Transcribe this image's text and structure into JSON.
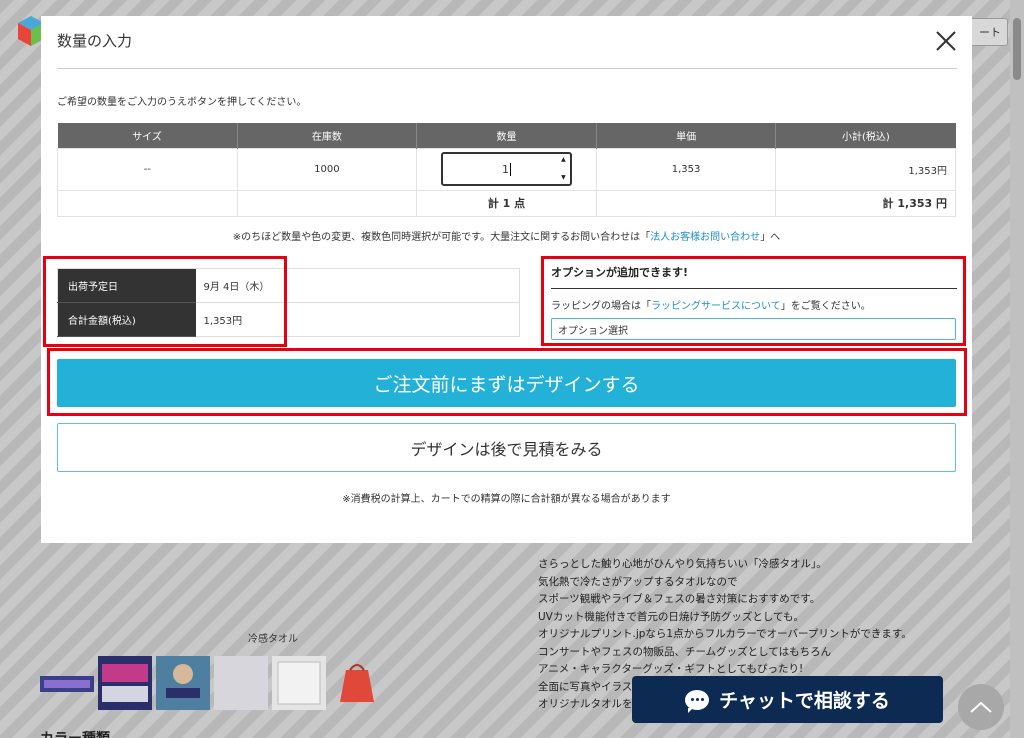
{
  "modal": {
    "title": "数量の入力",
    "instruction": "ご希望の数量をご入力のうえボタンを押してください。",
    "table": {
      "headers": [
        "サイズ",
        "在庫数",
        "数量",
        "単価",
        "小計(税込)"
      ],
      "row": {
        "size": "--",
        "stock": "1000",
        "quantity": "1",
        "unit_price": "1,353",
        "subtotal": "1,353円"
      },
      "total_qty": "計 1 点",
      "total_price": "計 1,353 円"
    },
    "note": {
      "before": "※のちほど数量や色の変更、複数色同時選択が可能です。大量注文に関するお問い合わせは「",
      "link": "法人お客様お問い合わせ",
      "after": "」へ"
    },
    "shipping": {
      "date_label": "出荷予定日",
      "date_value": "9月 4日（木）",
      "total_label": "合計金額(税込)",
      "total_value": "1,353円"
    },
    "options": {
      "title": "オプションが追加できます!",
      "desc_before": "ラッピングの場合は「",
      "desc_link": "ラッピングサービスについて",
      "desc_after": "」をご覧ください。",
      "select_value": "オプション選択"
    },
    "design_button": "ご注文前にまずはデザインする",
    "later_button": "デザインは後で見積をみる",
    "tax_note": "※消費税の計算上、カートでの精算の際に合計額が異なる場合があります"
  },
  "background": {
    "cart_button_fragment": "ート",
    "description_lines": [
      "さらっとした触り心地がひんやり気持ちいい「冷感タオル」。",
      "気化熱で冷たさがアップするタオルなので",
      "スポーツ観戦やライブ＆フェスの暑さ対策におすすめです。",
      "UVカット機能付きで首元の日焼け予防グッズとしても。",
      "オリジナルプリント.jpなら1点からフルカラーでオーバープリントができます。",
      "コンサートやフェスの物販品、チームグッズとしてはもちろん",
      "アニメ・キャラクターグッズ・ギフトとしてもぴったり!",
      "全面に写真やイラス",
      "オリジナルタオルを"
    ],
    "thumb_label": "冷感タオル",
    "title_fragment": "カラー種類"
  },
  "chat": {
    "label": "チャットで相談する"
  },
  "colors": {
    "accent": "#24b1d7",
    "highlight": "#e60012",
    "chat_bg": "#0d2a52"
  }
}
